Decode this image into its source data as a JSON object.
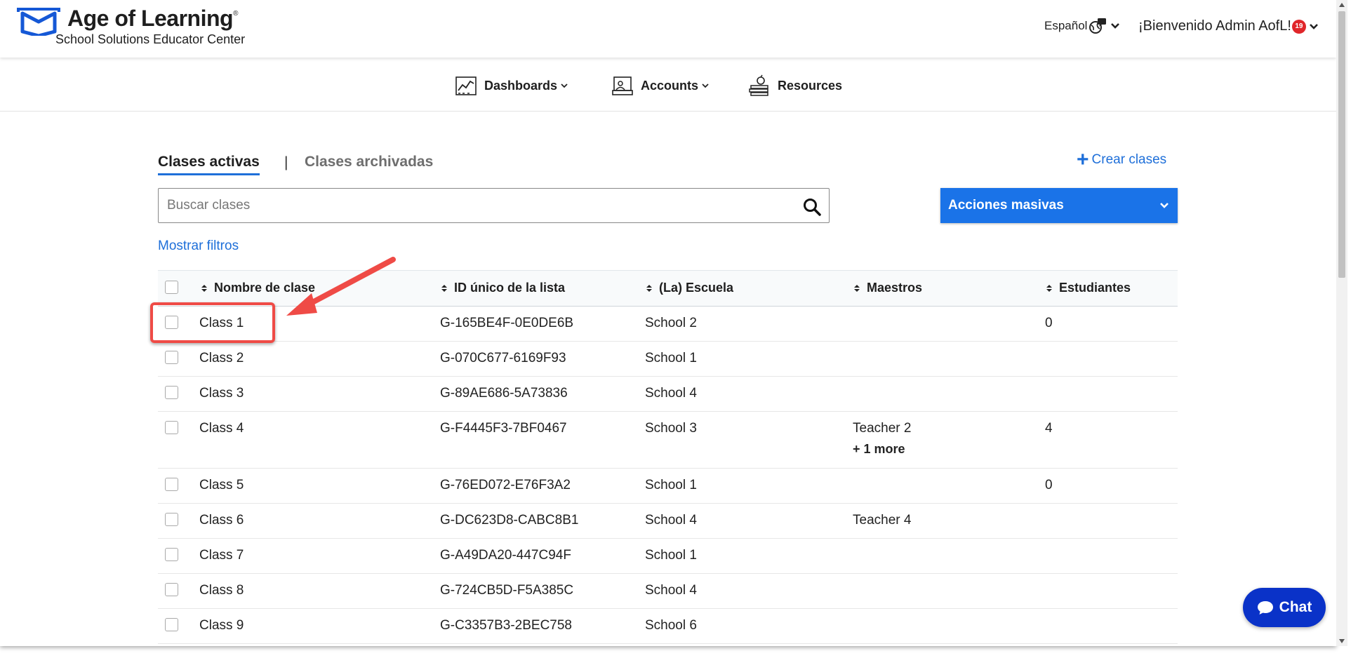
{
  "header": {
    "brand_title": "Age of Learning",
    "brand_mark": "®",
    "brand_subtitle": "School Solutions Educator Center",
    "language": "Español",
    "welcome": "¡Bienvenido Admin AofL!",
    "notifications_count": "19",
    "colors": {
      "logo": "#1558d6",
      "badge": "#e0262a"
    }
  },
  "nav": {
    "items": [
      {
        "label": "Dashboards",
        "icon": "line-chart-icon",
        "has_dropdown": true
      },
      {
        "label": "Accounts",
        "icon": "classroom-icon",
        "has_dropdown": true
      },
      {
        "label": "Resources",
        "icon": "books-apple-icon",
        "has_dropdown": false
      }
    ]
  },
  "tabs": {
    "active": "Clases activas",
    "separator": "|",
    "archived": "Clases archivadas"
  },
  "actions": {
    "create_plus": "+",
    "create_label": "Crear clases",
    "bulk_label": "Acciones masivas",
    "show_filters": "Mostrar filtros",
    "accent_color": "#1a73e8"
  },
  "search": {
    "placeholder": "Buscar clases",
    "value": ""
  },
  "table": {
    "columns": [
      "Nombre de clase",
      "ID único de la lista",
      "(La) Escuela",
      "Maestros",
      "Estudiantes"
    ],
    "rows": [
      {
        "name": "Class 1",
        "id": "G-165BE4F-0E0DE6B",
        "school": "School 2",
        "teachers": "",
        "more": "",
        "students": "0"
      },
      {
        "name": "Class 2",
        "id": "G-070C677-6169F93",
        "school": "School 1",
        "teachers": "",
        "more": "",
        "students": ""
      },
      {
        "name": "Class 3",
        "id": "G-89AE686-5A73836",
        "school": "School 4",
        "teachers": "",
        "more": "",
        "students": ""
      },
      {
        "name": "Class 4",
        "id": "G-F4445F3-7BF0467",
        "school": "School 3",
        "teachers": "Teacher 2",
        "more": "+ 1 more",
        "students": "4"
      },
      {
        "name": "Class 5",
        "id": "G-76ED072-E76F3A2",
        "school": "School 1",
        "teachers": "",
        "more": "",
        "students": "0"
      },
      {
        "name": "Class 6",
        "id": "G-DC623D8-CABC8B1",
        "school": "School 4",
        "teachers": "Teacher 4",
        "more": "",
        "students": ""
      },
      {
        "name": "Class 7",
        "id": "G-A49DA20-447C94F",
        "school": "School 1",
        "teachers": "",
        "more": "",
        "students": ""
      },
      {
        "name": "Class 8",
        "id": "G-724CB5D-F5A385C",
        "school": "School 4",
        "teachers": "",
        "more": "",
        "students": ""
      },
      {
        "name": "Class 9",
        "id": "G-C3357B3-2BEC758",
        "school": "School 6",
        "teachers": "",
        "more": "",
        "students": ""
      }
    ]
  },
  "annotation": {
    "highlight_color": "#ef4b46",
    "target_row": 1
  },
  "chat": {
    "label": "Chat",
    "color": "#0a32c8"
  }
}
